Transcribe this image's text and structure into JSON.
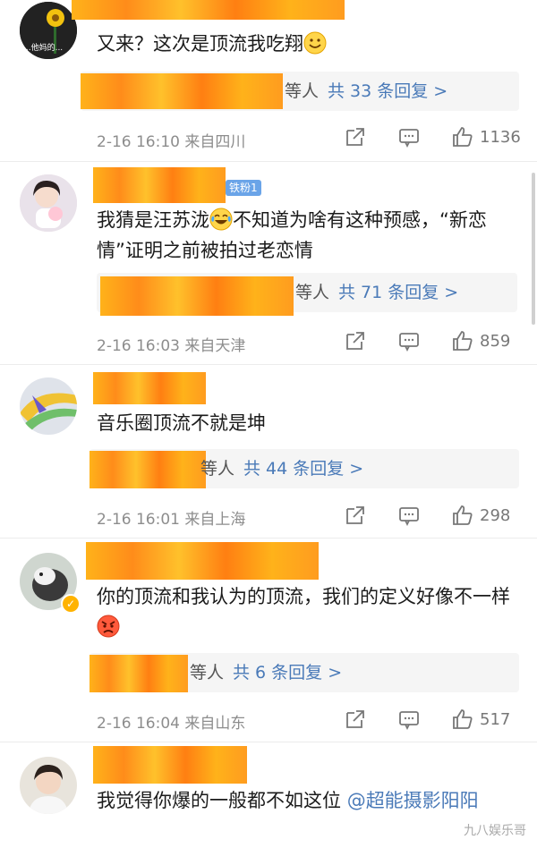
{
  "comments": [
    {
      "text": "又来？这次是顶流我吃翔",
      "replies_suffix": "等人",
      "replies_count": "共 33 条回复 >",
      "date": "2-16 16:10",
      "location": "来自四川",
      "likes": "1136",
      "avatar_caption": "...他妈的...",
      "emoji": "smile-emoji"
    },
    {
      "text_a": "我猜是汪苏泷",
      "text_b": "不知道为啥有这种预感，“新恋情”证明之前被拍过老恋情",
      "badge": "铁粉1",
      "replies_suffix": "等人",
      "replies_count": "共 71 条回复 >",
      "date": "2-16 16:03",
      "location": "来自天津",
      "likes": "859",
      "emoji": "tears-of-joy-emoji"
    },
    {
      "text": "音乐圈顶流不就是坤",
      "replies_suffix": "等人",
      "replies_count": "共 44 条回复 >",
      "date": "2-16 16:01",
      "location": "来自上海",
      "likes": "298"
    },
    {
      "text": "你的顶流和我认为的顶流，我们的定义好像不一样",
      "replies_suffix": "等人",
      "replies_count": "共 6 条回复 >",
      "date": "2-16 16:04",
      "location": "来自山东",
      "likes": "517",
      "emoji": "angry-emoji"
    },
    {
      "text": "我觉得你爆的一般都不如这位",
      "mention": "@超能摄影阳阳"
    }
  ],
  "watermark": "九八娱乐哥",
  "colors": {
    "link": "#4a7ab8",
    "meta": "#8d8d8d",
    "redaction": "#ffa31a"
  }
}
